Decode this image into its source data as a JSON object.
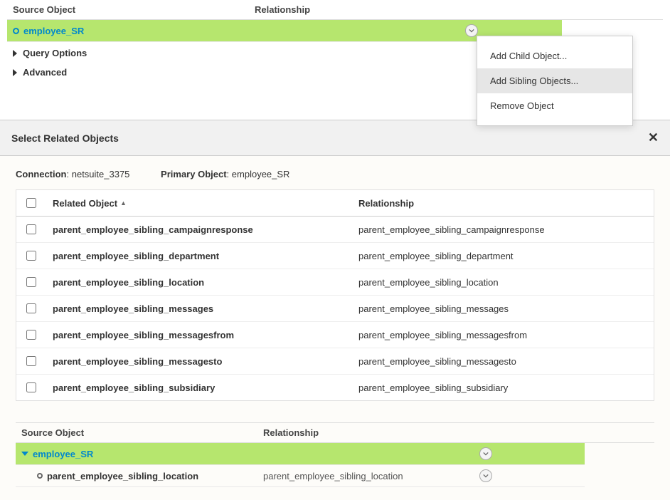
{
  "topTree": {
    "headers": {
      "source": "Source Object",
      "relationship": "Relationship"
    },
    "row": {
      "name": "employee_SR"
    },
    "sections": {
      "queryOptions": "Query Options",
      "advanced": "Advanced"
    }
  },
  "contextMenu": {
    "addChild": "Add Child Object...",
    "addSibling": "Add Sibling Objects...",
    "remove": "Remove Object"
  },
  "dialog": {
    "title": "Select Related Objects",
    "connectionLabel": "Connection",
    "connectionValue": "netsuite_3375",
    "primaryLabel": "Primary Object",
    "primaryValue": "employee_SR",
    "gridHeaders": {
      "relatedObject": "Related Object",
      "relationship": "Relationship"
    },
    "rows": [
      {
        "obj": "parent_employee_sibling_campaignresponse",
        "rel": "parent_employee_sibling_campaignresponse"
      },
      {
        "obj": "parent_employee_sibling_department",
        "rel": "parent_employee_sibling_department"
      },
      {
        "obj": "parent_employee_sibling_location",
        "rel": "parent_employee_sibling_location"
      },
      {
        "obj": "parent_employee_sibling_messages",
        "rel": "parent_employee_sibling_messages"
      },
      {
        "obj": "parent_employee_sibling_messagesfrom",
        "rel": "parent_employee_sibling_messagesfrom"
      },
      {
        "obj": "parent_employee_sibling_messagesto",
        "rel": "parent_employee_sibling_messagesto"
      },
      {
        "obj": "parent_employee_sibling_subsidiary",
        "rel": "parent_employee_sibling_subsidiary"
      }
    ]
  },
  "bottomTree": {
    "headers": {
      "source": "Source Object",
      "relationship": "Relationship"
    },
    "root": {
      "name": "employee_SR"
    },
    "child": {
      "name": "parent_employee_sibling_location",
      "rel": "parent_employee_sibling_location"
    }
  }
}
